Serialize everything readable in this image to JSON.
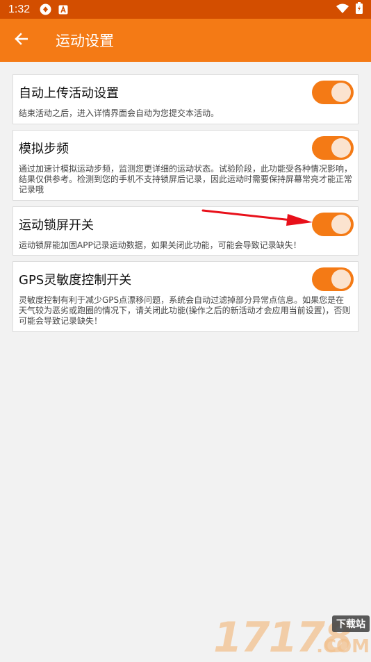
{
  "status_bar": {
    "time": "1:32",
    "icons": [
      "sync-icon",
      "a-badge-icon",
      "wifi-icon",
      "battery-icon"
    ]
  },
  "app_bar": {
    "title": "运动设置",
    "back_icon": "arrow-left-icon"
  },
  "settings": [
    {
      "title": "自动上传活动设置",
      "description": "结束活动之后，进入详情界面会自动为您提交本活动。",
      "enabled": true
    },
    {
      "title": "模拟步频",
      "description": "通过加速计模拟运动步频，监测您更详细的运动状态。试验阶段，此功能受各种情况影响，结果仅供参考。检测到您的手机不支持锁屏后记录，因此运动时需要保持屏幕常亮才能正常记录哦",
      "enabled": true
    },
    {
      "title": "运动锁屏开关",
      "description": "运动锁屏能加固APP记录运动数据，如果关闭此功能，可能会导致记录缺失！",
      "enabled": true
    },
    {
      "title": "GPS灵敏度控制开关",
      "description": "灵敏度控制有利于减少GPS点漂移问题，系统会自动过滤掉部分异常点信息。如果您是在天气较为恶劣或跑圈的情况下，请关闭此功能(操作之后的新活动才会应用当前设置)，否则可能会导致记录缺失！",
      "enabled": true
    }
  ],
  "watermark": {
    "digits": "17178",
    "badge": "下载站",
    "suffix": ".COM"
  },
  "colors": {
    "accent": "#f47a15",
    "status_bar": "#d34e00",
    "arrow": "#e8101a"
  }
}
